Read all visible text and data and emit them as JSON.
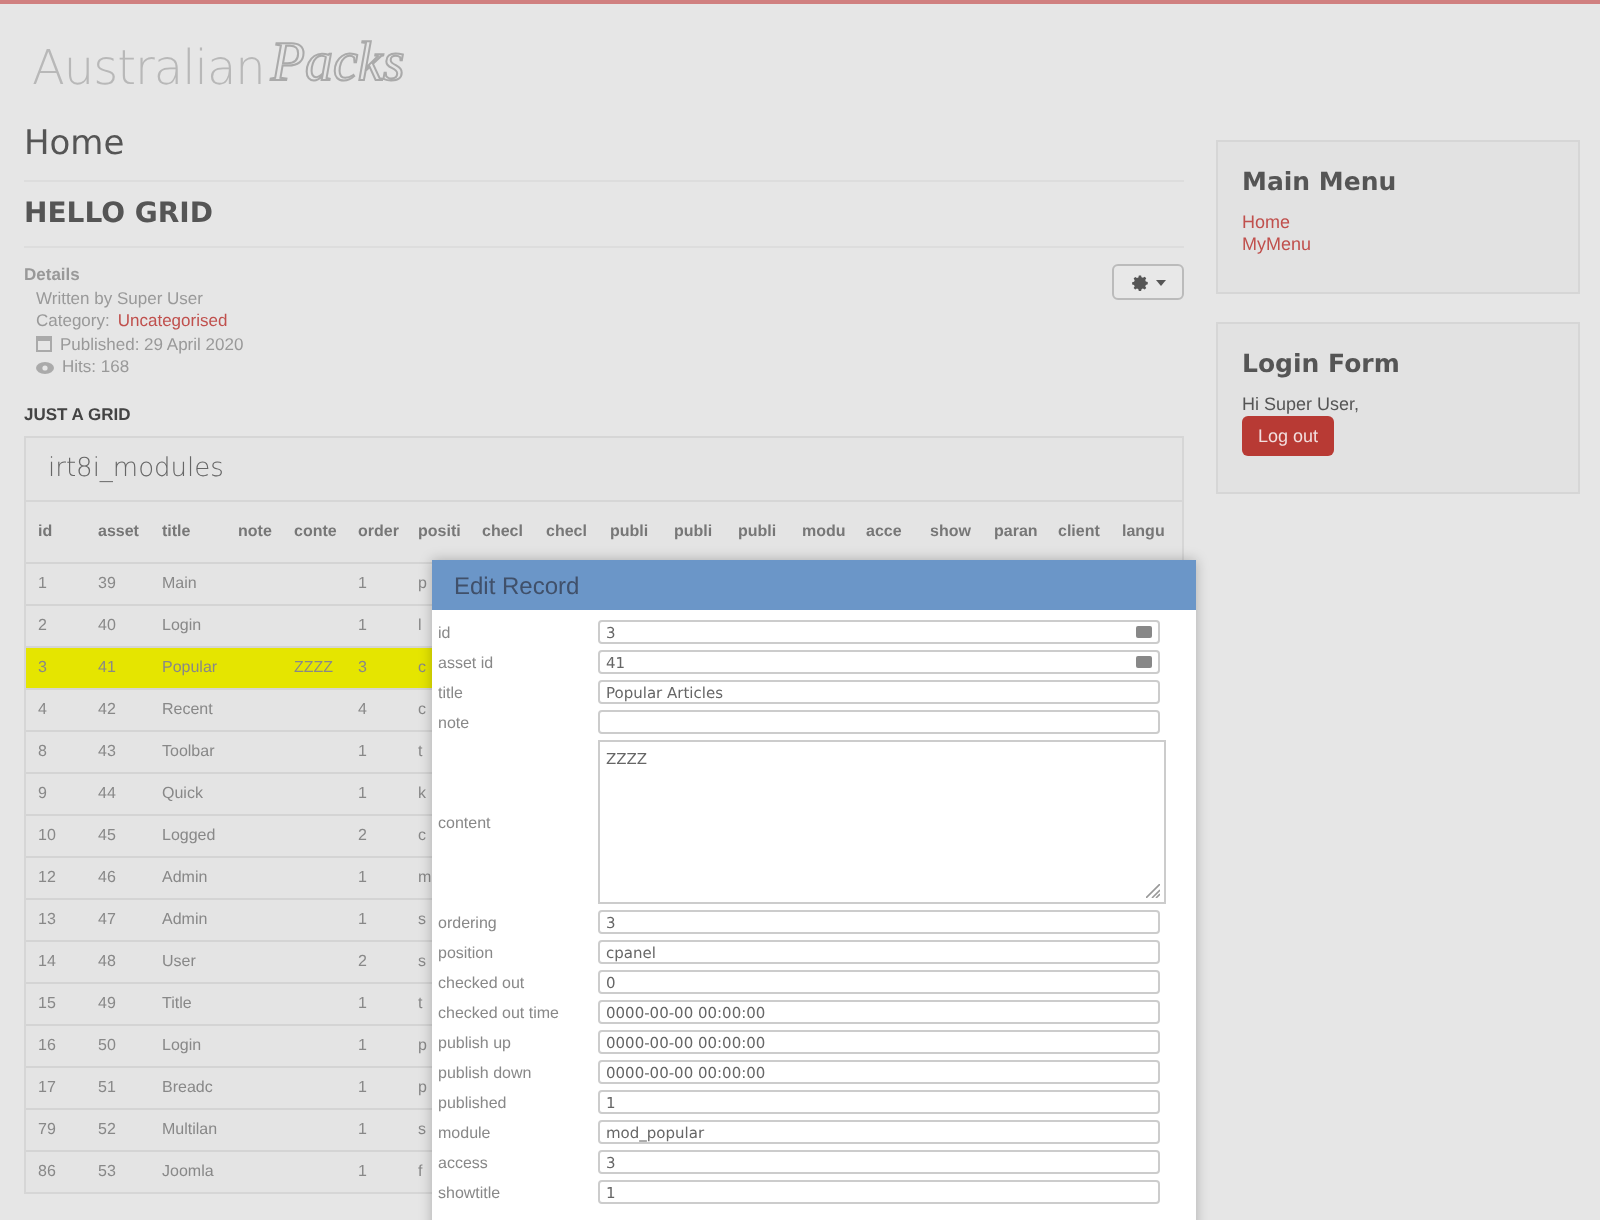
{
  "logo": {
    "plain": "Australian",
    "script": "Packs"
  },
  "page_title": "Home",
  "article": {
    "title": "HELLO GRID",
    "details_label": "Details",
    "author": "Written by Super User",
    "category_label": "Category:",
    "category": "Uncategorised",
    "published": "Published: 29 April 2020",
    "hits": "Hits: 168",
    "section": "JUST A GRID"
  },
  "grid": {
    "title": "irt8i_modules",
    "columns": [
      "id",
      "asset",
      "title",
      "note",
      "conte",
      "order",
      "positi",
      "checl",
      "checl",
      "publi",
      "publi",
      "publi",
      "modu",
      "acce",
      "show",
      "paran",
      "client",
      "langu"
    ],
    "rows": [
      {
        "cells": [
          "1",
          "39",
          "Main",
          "",
          "",
          "1",
          "p"
        ],
        "selected": false
      },
      {
        "cells": [
          "2",
          "40",
          "Login",
          "",
          "",
          "1",
          "l"
        ],
        "selected": false
      },
      {
        "cells": [
          "3",
          "41",
          "Popular",
          "",
          "ZZZZ",
          "3",
          "c"
        ],
        "selected": true
      },
      {
        "cells": [
          "4",
          "42",
          "Recent",
          "",
          "",
          "4",
          "c"
        ],
        "selected": false
      },
      {
        "cells": [
          "8",
          "43",
          "Toolbar",
          "",
          "",
          "1",
          "t"
        ],
        "selected": false
      },
      {
        "cells": [
          "9",
          "44",
          "Quick",
          "",
          "",
          "1",
          "k"
        ],
        "selected": false
      },
      {
        "cells": [
          "10",
          "45",
          "Logged",
          "",
          "",
          "2",
          "c"
        ],
        "selected": false
      },
      {
        "cells": [
          "12",
          "46",
          "Admin",
          "",
          "",
          "1",
          "m"
        ],
        "selected": false
      },
      {
        "cells": [
          "13",
          "47",
          "Admin",
          "",
          "",
          "1",
          "s"
        ],
        "selected": false
      },
      {
        "cells": [
          "14",
          "48",
          "User",
          "",
          "",
          "2",
          "s"
        ],
        "selected": false
      },
      {
        "cells": [
          "15",
          "49",
          "Title",
          "",
          "",
          "1",
          "t"
        ],
        "selected": false
      },
      {
        "cells": [
          "16",
          "50",
          "Login",
          "",
          "",
          "1",
          "p"
        ],
        "selected": false
      },
      {
        "cells": [
          "17",
          "51",
          "Breadc",
          "",
          "",
          "1",
          "p"
        ],
        "selected": false
      },
      {
        "cells": [
          "79",
          "52",
          "Multilan",
          "",
          "",
          "1",
          "s"
        ],
        "selected": false
      },
      {
        "cells": [
          "86",
          "53",
          "Joomla",
          "",
          "",
          "1",
          "f"
        ],
        "selected": false
      }
    ]
  },
  "sidebar": [
    {
      "kind": "menu",
      "title": "Main Menu",
      "links": [
        "Home",
        "MyMenu"
      ]
    },
    {
      "kind": "login",
      "title": "Login Form",
      "greeting": "Hi Super User,",
      "button": "Log out"
    }
  ],
  "dialog": {
    "title": "Edit Record",
    "fields": [
      {
        "label": "id",
        "value": "3",
        "kind": "number"
      },
      {
        "label": "asset id",
        "value": "41",
        "kind": "number"
      },
      {
        "label": "title",
        "value": "Popular Articles",
        "kind": "text"
      },
      {
        "label": "note",
        "kind": "text"
      },
      {
        "label": "content",
        "value": "ZZZZ",
        "kind": "textarea"
      },
      {
        "label": "ordering",
        "value": "3",
        "kind": "text"
      },
      {
        "label": "position",
        "value": "cpanel",
        "kind": "text"
      },
      {
        "label": "checked out",
        "value": "0",
        "kind": "text"
      },
      {
        "label": "checked out time",
        "value": "0000-00-00 00:00:00",
        "kind": "text"
      },
      {
        "label": "publish up",
        "value": "0000-00-00 00:00:00",
        "kind": "text"
      },
      {
        "label": "publish down",
        "value": "0000-00-00 00:00:00",
        "kind": "text"
      },
      {
        "label": "published",
        "value": "1",
        "kind": "text"
      },
      {
        "label": "module",
        "value": "mod_popular",
        "kind": "text"
      },
      {
        "label": "access",
        "value": "3",
        "kind": "text"
      },
      {
        "label": "showtitle",
        "value": "1",
        "kind": "text"
      }
    ]
  }
}
